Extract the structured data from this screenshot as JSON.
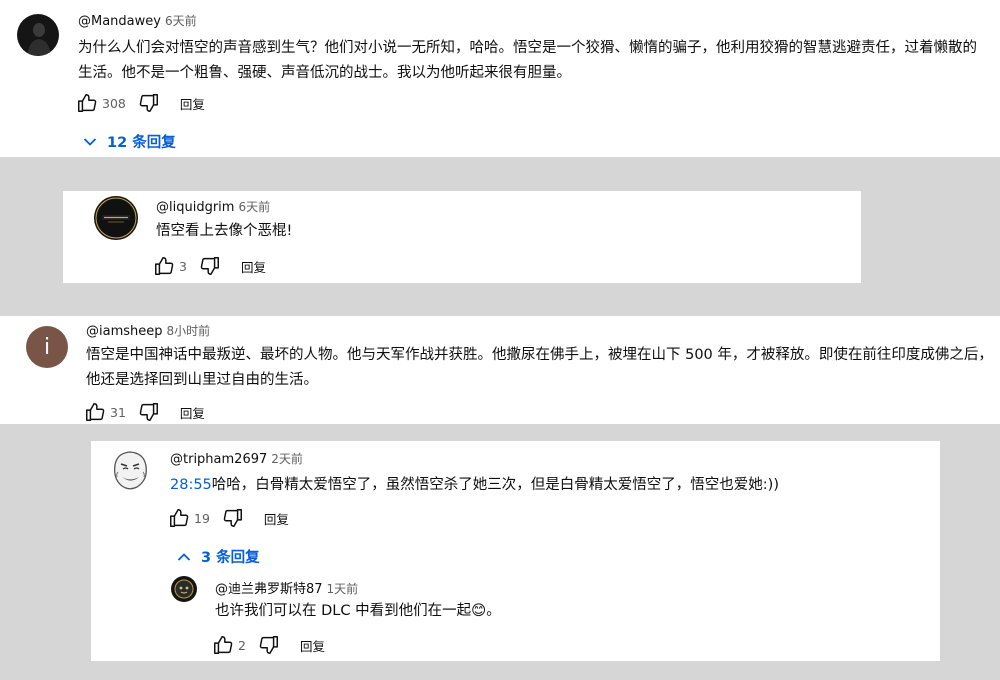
{
  "comments": [
    {
      "author": "@Mandawey",
      "time": "6天前",
      "text": "为什么人们会对悟空的声音感到生气？他们对小说一无所知，哈哈。悟空是一个狡猾、懒惰的骗子，他利用狡猾的智慧逃避责任，过着懒散的生活。他不是一个粗鲁、强硬、声音低沉的战士。我以为他听起来很有胆量。",
      "likes": "308",
      "reply_label": "回复",
      "replies_toggle": "12 条回复"
    },
    {
      "author": "@liquidgrim",
      "time": "6天前",
      "avatar_text": "NIMOTEUM",
      "text": "悟空看上去像个恶棍!",
      "likes": "3",
      "reply_label": "回复"
    },
    {
      "author": "@iamsheep",
      "time": "8小时前",
      "avatar_letter": "i",
      "text": "悟空是中国神话中最叛逆、最坏的人物。他与天军作战并获胜。他撒尿在佛手上，被埋在山下 500 年，才被释放。即使在前往印度成佛之后，他还是选择回到山里过自由的生活。",
      "likes": "31",
      "reply_label": "回复"
    },
    {
      "author": "@tripham2697",
      "time": "2天前",
      "timestamp": "28:55",
      "text": "哈哈，白骨精太爱悟空了，虽然悟空杀了她三次，但是白骨精太爱悟空了，悟空也爱她:))",
      "likes": "19",
      "reply_label": "回复",
      "replies_toggle": "3 条回复"
    },
    {
      "author": "@迪兰弗罗斯特87",
      "time": "1天前",
      "text": "也许我们可以在 DLC 中看到他们在一起",
      "emoji": "😊",
      "suffix": "。",
      "likes": "2",
      "reply_label": "回复"
    }
  ],
  "colors": {
    "link": "#065fd4",
    "background": "#d6d6d6",
    "card": "#ffffff"
  }
}
